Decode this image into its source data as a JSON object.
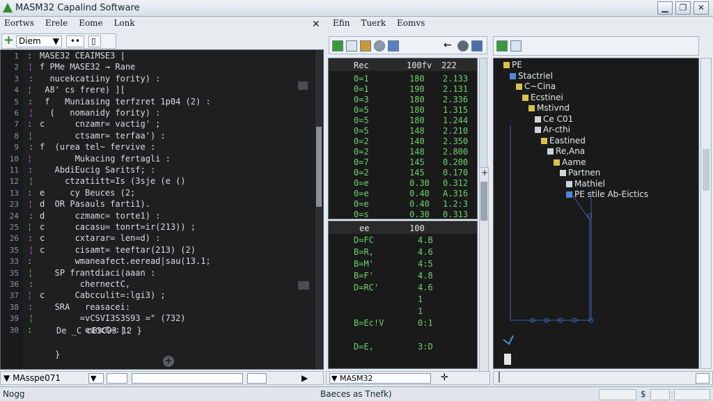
{
  "window": {
    "title": "MASM32 Capalind Software",
    "min": "▁",
    "max": "❐",
    "close": "✕"
  },
  "editor": {
    "menu": [
      "Eortws",
      "Erele",
      "Eome",
      "Lonk"
    ],
    "close": "✕",
    "toolbar": {
      "combo": "Diem",
      "combo_arrow": "▼",
      "btn": "••"
    },
    "line_numbers": [
      "1",
      "2",
      "3",
      "4",
      "5",
      "6",
      "7",
      "8",
      "9",
      "10",
      "11",
      "12",
      "13",
      "23",
      "24",
      "25",
      "26",
      "35",
      "33",
      "35",
      "36",
      "37",
      "38",
      "39",
      "30"
    ],
    "lines": [
      "MASE32 CEAIMSE3 |",
      "f PMe MASE32 → Rane",
      "  nucekcatiiny fority) :",
      " A8' cs frere) ][",
      " f   Muniasing terfzret 1p04 (2) :",
      "  (   nomanidy fority) :",
      "c      cnzamr= vactig' ;",
      "       ctsamr= terfaa') :",
      "f  (urea tel~ fervive :",
      "       Mukacing fertagli :",
      "   AbdiEucig Saritsf; :",
      "     ctzatiitt=Is (3sje (e ()",
      "e     cy Beuces (2;",
      "d  OR Pasauls farti1).",
      "d      czmamc= torte1) :",
      "c      cacasu= tonrt=ir(213)) ;",
      "c      cxtarar= len=d) :",
      "c      cisamt= teeftar(213) (2)",
      "       wmaneafect.eeread|sau(13.1;",
      "   SP frantdiaci(aaan :",
      "        chernectC,",
      "c      Cabcculit=:lgi3) ;",
      "   SRA   reasacei:",
      "        =vCSVI3S3S93 =\" (732)",
      "         euncC=:|:"
    ],
    "last_line": "De _C cE3C93 12 }",
    "close_brace": "}",
    "status_combo": "MAsspe071",
    "status_arrow": "▼",
    "status_small": "▼",
    "footer_left": "Nogg"
  },
  "middle": {
    "menu": [
      "Efin",
      "Tuerk",
      "Eomvs"
    ],
    "top_table": {
      "header": [
        "Rec",
        "100fv",
        "222"
      ],
      "rows": [
        [
          "0=1",
          "180",
          "2.133"
        ],
        [
          "0=1",
          "190",
          "2.131"
        ],
        [
          "0=3",
          "180",
          "2.336"
        ],
        [
          "0=5",
          "180",
          "1.315"
        ],
        [
          "0=5",
          "180",
          "1.244"
        ],
        [
          "0=5",
          "148",
          "2.210"
        ],
        [
          "0=2",
          "140",
          "2.350"
        ],
        [
          "0=2",
          "148",
          "2.800"
        ],
        [
          "0=7",
          "145",
          "0.200"
        ],
        [
          "0=2",
          "145",
          "0.170"
        ],
        [
          "0=e",
          "0.30",
          "0.312"
        ],
        [
          "0=e",
          "0.40",
          "A.316"
        ],
        [
          "0=e",
          "0.40",
          "1.2:3"
        ],
        [
          "0=s",
          "0.30",
          "0.313"
        ]
      ]
    },
    "bottom_table": {
      "header": [
        "ee",
        "100"
      ],
      "rows": [
        [
          "D=FC",
          "4.B"
        ],
        [
          "B=R,",
          "4.6"
        ],
        [
          "B=M'",
          "4:5"
        ],
        [
          "B=F'",
          "4.8"
        ],
        [
          "D=RC'",
          "4.6"
        ],
        [
          "",
          "1"
        ],
        [
          "",
          "1"
        ],
        [
          "B=Ec!V",
          "0:1"
        ],
        [
          "",
          ""
        ],
        [
          "D=E,",
          "3:D"
        ]
      ]
    },
    "status_combo": "MASM32",
    "status_arrow": "▼",
    "footer": "Baeces as Tnefk)"
  },
  "tree": {
    "nodes": [
      {
        "label": "PE",
        "depth": 0,
        "color": "#d8c24a"
      },
      {
        "label": "Stactriel",
        "depth": 1,
        "color": "#4f86d9"
      },
      {
        "label": "C~Cina",
        "depth": 2,
        "color": "#d8c24a"
      },
      {
        "label": "Ecstinei",
        "depth": 3,
        "color": "#d8c24a"
      },
      {
        "label": "Mstivnd",
        "depth": 4,
        "color": "#d8c24a"
      },
      {
        "label": "Ce C01",
        "depth": 5,
        "color": "#cfd4da"
      },
      {
        "label": "Ar-cthi",
        "depth": 5,
        "color": "#cfd4da"
      },
      {
        "label": "Eastined",
        "depth": 6,
        "color": "#d8c24a"
      },
      {
        "label": "Re,Ana",
        "depth": 7,
        "color": "#cfd4da"
      },
      {
        "label": "Aame",
        "depth": 8,
        "color": "#d8c24a"
      },
      {
        "label": "Partnen",
        "depth": 9,
        "color": "#cfd4da"
      },
      {
        "label": "Mathiel",
        "depth": 10,
        "color": "#cfd4da"
      },
      {
        "label": "PE stile Ab-Eictics",
        "depth": 10,
        "color": "#4f86d9"
      }
    ],
    "footer_right": "$"
  }
}
